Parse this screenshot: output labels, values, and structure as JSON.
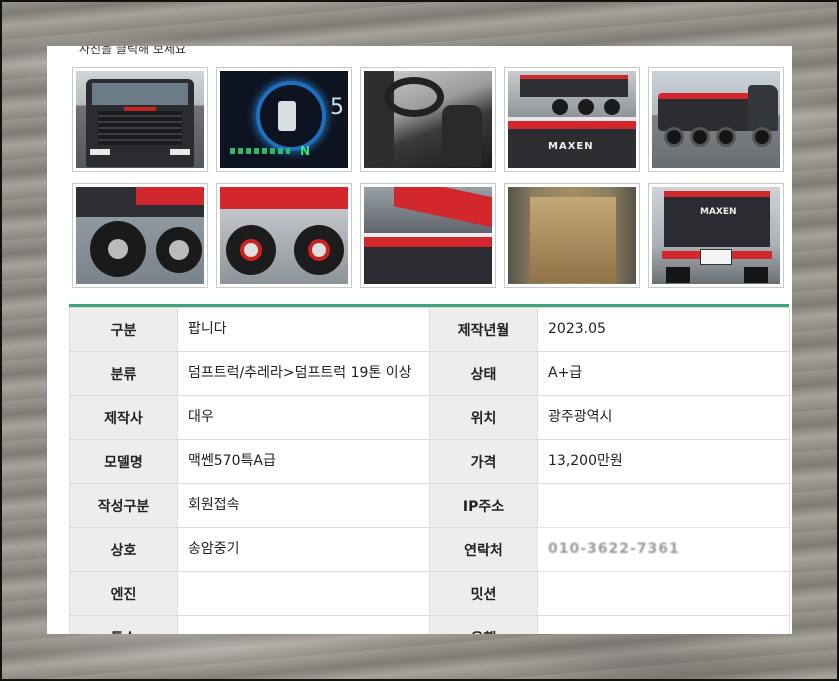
{
  "hint_text": "사진을 클릭해 보세요",
  "thumbnails": [
    {
      "name": "truck-front-photo"
    },
    {
      "name": "dashboard-photo"
    },
    {
      "name": "cab-interior-photo"
    },
    {
      "name": "truck-body-photos"
    },
    {
      "name": "truck-side-photo"
    },
    {
      "name": "front-wheels-photo"
    },
    {
      "name": "rear-wheels-photo"
    },
    {
      "name": "dump-bed-photos"
    },
    {
      "name": "dump-bed-interior-photo"
    },
    {
      "name": "truck-rear-photo"
    }
  ],
  "thumb_text": {
    "brand": "MAXEN",
    "dash_number": "5",
    "dash_gear": "N"
  },
  "table": {
    "rows": [
      {
        "l1": "구분",
        "v1": "팝니다",
        "l2": "제작년월",
        "v2": "2023.05"
      },
      {
        "l1": "분류",
        "v1": "덤프트럭/추레라>덤프트럭 19톤 이상",
        "l2": "상태",
        "v2": "A+급"
      },
      {
        "l1": "제작사",
        "v1": "대우",
        "l2": "위치",
        "v2": "광주광역시"
      },
      {
        "l1": "모델명",
        "v1": "맥쎈570특A급",
        "l2": "가격",
        "v2": "13,200만원"
      },
      {
        "l1": "작성구분",
        "v1": "회원접속",
        "l2": "IP주소",
        "v2": ""
      },
      {
        "l1": "상호",
        "v1": "송암중기",
        "l2": "연락처",
        "v2": "010-3622-7361"
      },
      {
        "l1": "엔진",
        "v1": "",
        "l2": "밋션",
        "v2": ""
      },
      {
        "l1": "특수",
        "v1": "",
        "l2": "운행",
        "v2": ""
      }
    ]
  },
  "colors": {
    "accent_border": "#3ba57a",
    "label_bg": "#ededed",
    "truck_red": "#d3272e"
  }
}
